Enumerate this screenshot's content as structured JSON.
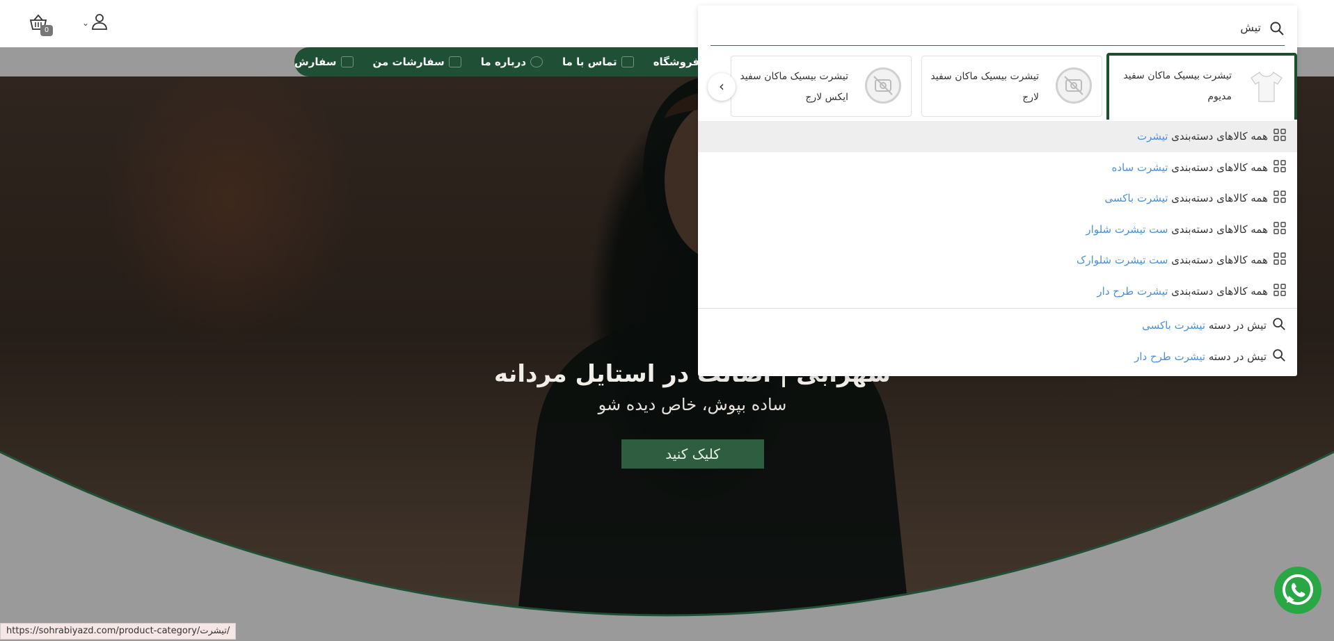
{
  "header": {
    "cart_count": "0"
  },
  "nav": {
    "items": [
      {
        "label": "فروشگاه",
        "icon": "shop-icon"
      },
      {
        "label": "تماس با ما",
        "icon": "phone-icon"
      },
      {
        "label": "درباره ما",
        "icon": "info-icon"
      },
      {
        "label": "سفارشات من",
        "icon": "truck-icon"
      },
      {
        "label": "سفارش",
        "icon": "order-icon"
      }
    ]
  },
  "hero": {
    "title": "سهرابی | اصالت در استایل مردانه",
    "subtitle": "ساده بپوش، خاص دیده شو",
    "button": "کلیک کنید"
  },
  "search": {
    "value": "تیش",
    "products": [
      {
        "name": "تیشرت بیسیک ماکان سفید مدیوم",
        "selected": true
      },
      {
        "name": "تیشرت بیسیک ماکان سفید لارج",
        "selected": false
      },
      {
        "name": "تیشرت بیسیک ماکان سفید ایکس لارج",
        "selected": false
      }
    ],
    "category_suggestions": [
      {
        "prefix": "همه کالاهای دسته‌بندی",
        "term": "تیشرت"
      },
      {
        "prefix": "همه کالاهای دسته‌بندی",
        "term": "تیشرت ساده"
      },
      {
        "prefix": "همه کالاهای دسته‌بندی",
        "term": "تیشرت باکسی"
      },
      {
        "prefix": "همه کالاهای دسته‌بندی",
        "term": "ست تیشرت شلوار"
      },
      {
        "prefix": "همه کالاهای دسته‌بندی",
        "term": "ست تیشرت شلوارک"
      },
      {
        "prefix": "همه کالاهای دسته‌بندی",
        "term": "تیشرت طرح دار"
      }
    ],
    "in_category_suggestions": [
      {
        "prefix": "تیش در دسته",
        "term": "تیشرت باکسی"
      },
      {
        "prefix": "تیش در دسته",
        "term": "تیشرت طرح دار"
      }
    ]
  },
  "status_bar": {
    "url": "https://sohrabiyazd.com/product-category/تیشرت/"
  },
  "colors": {
    "nav_bg": "#1f4f34",
    "accent_link": "#4a90d9",
    "selected_border": "#1b4d2e",
    "whatsapp": "#29a744"
  }
}
